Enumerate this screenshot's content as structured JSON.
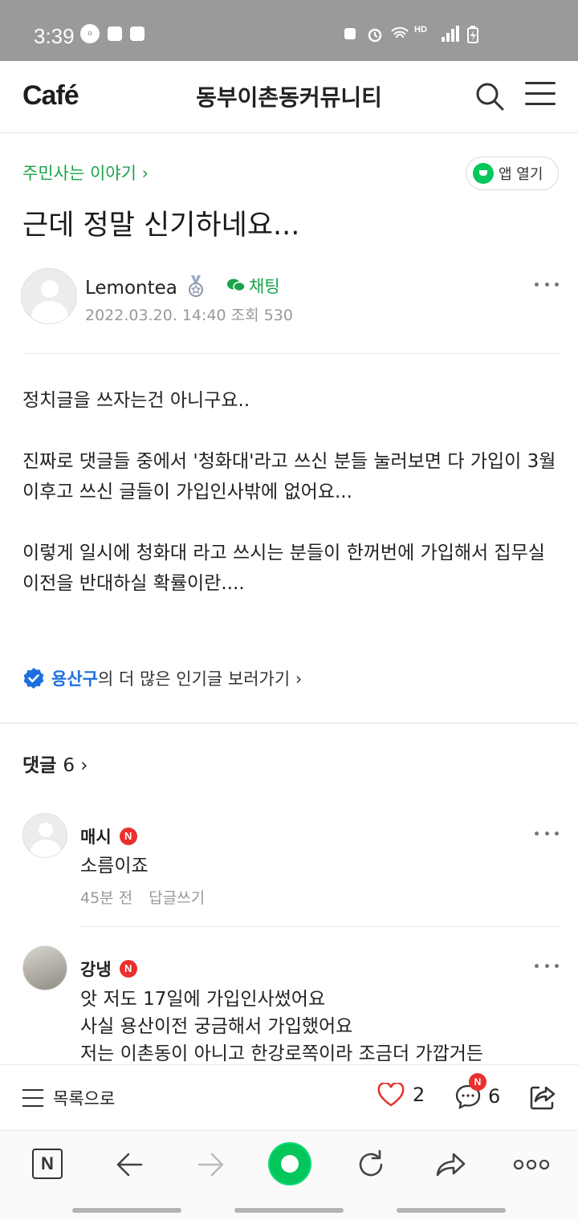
{
  "status_bar": {
    "time": "3:39",
    "left_icons": [
      "olock-icon",
      "dx-icon",
      "screenshot-icon"
    ],
    "right_icons": [
      "recycle-icon",
      "alarm-icon",
      "wifi-icon",
      "hd-voice-icon",
      "signal-icon",
      "battery-charging-icon"
    ]
  },
  "header": {
    "logo": "Café",
    "cafe_name": "동부이촌동커뮤니티"
  },
  "post": {
    "board": "주민사는 이야기 ›",
    "app_open": "앱 열기",
    "title": "근데 정말 신기하네요...",
    "author": "Lemontea",
    "chat_label": "채팅",
    "date": "2022.03.20. 14:40",
    "views": "조회 530",
    "body": [
      "정치글을 쓰자는건 아니구요..",
      "진짜로 댓글들 중에서 '청화대'라고 쓰신 분들  눌러보면 다 가입이 3월이후고  쓰신 글들이 가입인사밖에 없어요...",
      "이렇게 일시에 청화대 라고 쓰시는 분들이 한꺼번에 가입해서 집무실이전을 반대하실 확률이란...."
    ],
    "popular_region": "용산구",
    "popular_text": "의 더 많은 인기글 보러가기 ›"
  },
  "comments": {
    "label": "댓글",
    "count": "6 ›",
    "items": [
      {
        "name": "매시",
        "badge": "N",
        "text": "소름이죠",
        "time": "45분 전",
        "reply": "답글쓰기"
      },
      {
        "name": "강냉",
        "badge": "N",
        "lines": [
          "앗 저도 17일에 가입인사썼어요",
          "사실 용산이전 궁금해서 가입했어요",
          "저는 이촌동이 아니고 한강로쪽이라 조금더 가깝거든"
        ]
      }
    ]
  },
  "action_bar": {
    "list_label": "목록으로",
    "likes": "2",
    "comments": "6",
    "comment_badge": "N"
  },
  "browser_nav": {
    "home_label": "N"
  },
  "colors": {
    "accent_green": "#19a34a",
    "naver_green": "#03c75a",
    "badge_red": "#e9302e",
    "link_blue": "#1d6fe0"
  }
}
